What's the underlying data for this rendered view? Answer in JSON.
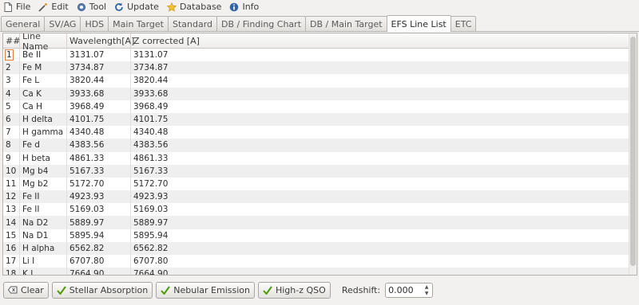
{
  "menu": [
    {
      "label": "File",
      "icon": "file-icon"
    },
    {
      "label": "Edit",
      "icon": "wand-icon"
    },
    {
      "label": "Tool",
      "icon": "tool-icon"
    },
    {
      "label": "Update",
      "icon": "refresh-icon"
    },
    {
      "label": "Database",
      "icon": "star-icon"
    },
    {
      "label": "Info",
      "icon": "info-icon"
    }
  ],
  "tabs": [
    {
      "label": "General"
    },
    {
      "label": "SV/AG"
    },
    {
      "label": "HDS"
    },
    {
      "label": "Main Target"
    },
    {
      "label": "Standard"
    },
    {
      "label": "DB / Finding Chart"
    },
    {
      "label": "DB / Main Target"
    },
    {
      "label": "EFS Line List",
      "active": true
    },
    {
      "label": "ETC"
    }
  ],
  "table": {
    "headers": [
      "##",
      "Line Name",
      "Wavelength[A]",
      "Z corrected [A]"
    ],
    "rows": [
      [
        "1",
        "Be II",
        "3131.07",
        "3131.07"
      ],
      [
        "2",
        "Fe M",
        "3734.87",
        "3734.87"
      ],
      [
        "3",
        "Fe L",
        "3820.44",
        "3820.44"
      ],
      [
        "4",
        "Ca K",
        "3933.68",
        "3933.68"
      ],
      [
        "5",
        "Ca H",
        "3968.49",
        "3968.49"
      ],
      [
        "6",
        "H delta",
        "4101.75",
        "4101.75"
      ],
      [
        "7",
        "H gamma",
        "4340.48",
        "4340.48"
      ],
      [
        "8",
        "Fe d",
        "4383.56",
        "4383.56"
      ],
      [
        "9",
        "H beta",
        "4861.33",
        "4861.33"
      ],
      [
        "10",
        "Mg b4",
        "5167.33",
        "5167.33"
      ],
      [
        "11",
        "Mg b2",
        "5172.70",
        "5172.70"
      ],
      [
        "12",
        "Fe II",
        "4923.93",
        "4923.93"
      ],
      [
        "13",
        "Fe II",
        "5169.03",
        "5169.03"
      ],
      [
        "14",
        "Na D2",
        "5889.97",
        "5889.97"
      ],
      [
        "15",
        "Na D1",
        "5895.94",
        "5895.94"
      ],
      [
        "16",
        "H alpha",
        "6562.82",
        "6562.82"
      ],
      [
        "17",
        "Li I",
        "6707.80",
        "6707.80"
      ],
      [
        "18",
        "K I",
        "7664.90",
        "7664.90"
      ]
    ]
  },
  "toolbar": {
    "clear_label": "Clear",
    "stellar_label": "Stellar Absorption",
    "nebular_label": "Nebular Emission",
    "highz_label": "High-z QSO",
    "redshift_label": "Redshift:",
    "redshift_value": "0.000"
  },
  "colors": {
    "focus_outline": "#e07a3a",
    "check_green": "#4e9a06",
    "alt_row": "#efefef"
  }
}
